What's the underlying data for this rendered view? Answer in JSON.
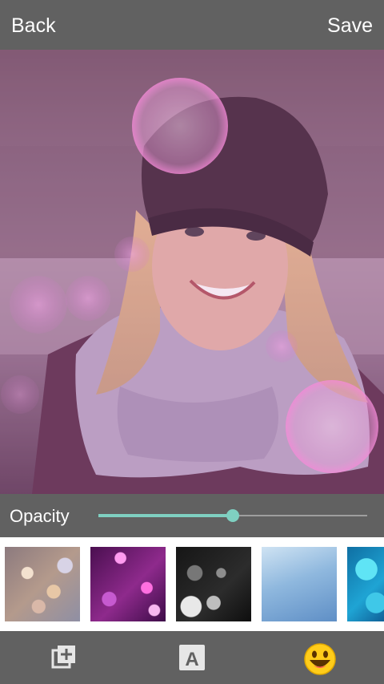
{
  "header": {
    "back_label": "Back",
    "save_label": "Save"
  },
  "photo": {
    "description_icon": "woman-portrait-with-bokeh-overlay"
  },
  "opacity": {
    "label": "Opacity",
    "value": 0.5,
    "accent_color": "#7fd0c1"
  },
  "overlays": [
    {
      "icon": "bokeh-gold-thumbnail"
    },
    {
      "icon": "bokeh-magenta-thumbnail"
    },
    {
      "icon": "bokeh-monochrome-thumbnail"
    },
    {
      "icon": "glitter-blue-thumbnail"
    },
    {
      "icon": "bokeh-cyan-thumbnail"
    }
  ],
  "toolbar": {
    "items": [
      {
        "icon": "add-layer-icon"
      },
      {
        "icon": "text-icon",
        "glyph": "A"
      },
      {
        "icon": "emoji-icon"
      }
    ]
  },
  "colors": {
    "bar_background": "#616161",
    "accent": "#7fd0c1"
  }
}
